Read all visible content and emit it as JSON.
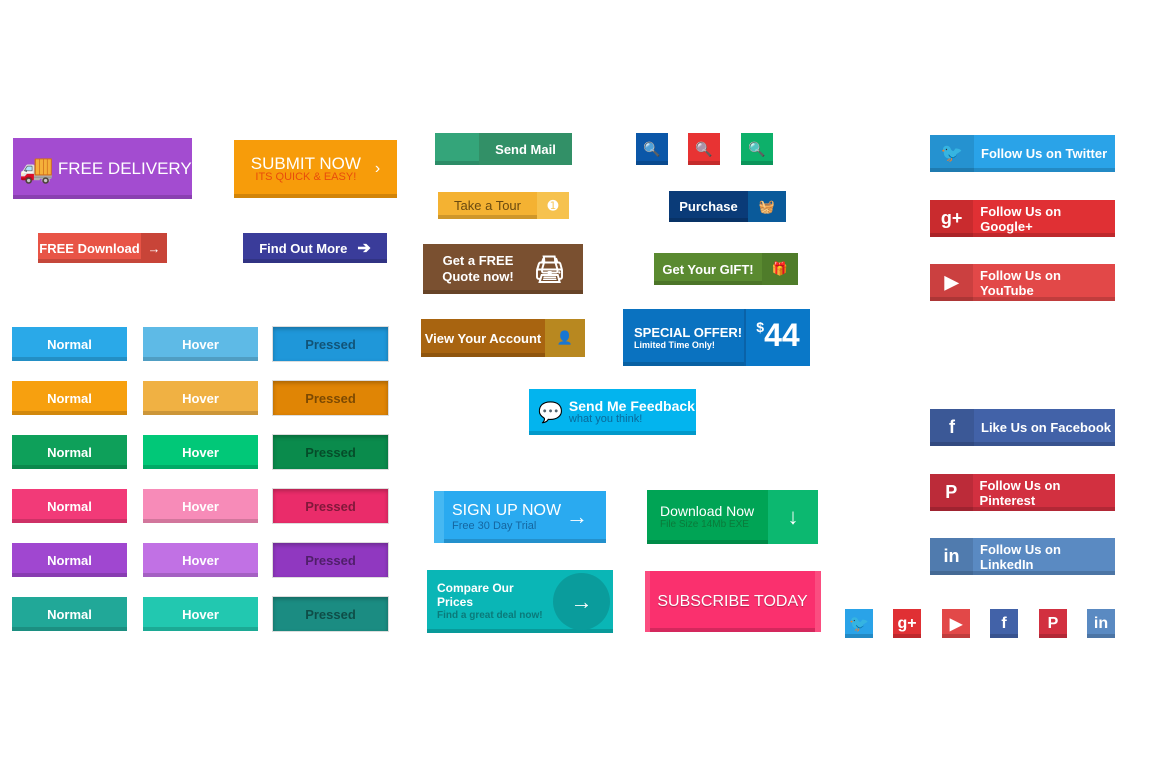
{
  "hero": {
    "free_delivery": "FREE DELIVERY",
    "submit_now": "SUBMIT NOW",
    "submit_sub": "ITS QUICK & EASY!",
    "free_download": "FREE Download",
    "find_out_more": "Find Out More"
  },
  "middle": {
    "send_mail": "Send Mail",
    "take_tour": "Take a Tour",
    "quote_line1": "Get a FREE",
    "quote_line2": "Quote now!",
    "view_account": "View Your Account",
    "purchase": "Purchase",
    "gift": "Get Your GIFT!",
    "special": "SPECIAL OFFER!",
    "special_sub": "Limited Time Only!",
    "currency": "$",
    "price": "44",
    "feedback": "Send Me Feedback",
    "feedback_sub": "what you think!",
    "signup": "SIGN UP NOW",
    "signup_sub": "Free 30 Day Trial",
    "download": "Download Now",
    "download_sub": "File Size 14Mb EXE",
    "compare": "Compare Our Prices",
    "compare_sub": "Find a great deal now!",
    "subscribe": "SUBSCRIBE TODAY"
  },
  "search_buttons": [
    {
      "color": "#0b57a8"
    },
    {
      "color": "#e83333"
    },
    {
      "color": "#0db06a"
    }
  ],
  "states": {
    "labels": [
      "Normal",
      "Hover",
      "Pressed"
    ],
    "rows": [
      {
        "colors": [
          "#2aa9e8",
          "#5ebae6",
          "#1f97d9"
        ]
      },
      {
        "colors": [
          "#f7a00f",
          "#f0b143",
          "#e08505"
        ]
      },
      {
        "colors": [
          "#0ea05a",
          "#01c878",
          "#0a8b4c"
        ]
      },
      {
        "colors": [
          "#f23a78",
          "#f78bb8",
          "#ea2c6a"
        ]
      },
      {
        "colors": [
          "#a047d0",
          "#c171e4",
          "#9038c0"
        ]
      },
      {
        "colors": [
          "#21a898",
          "#22c8b0",
          "#1b8c82"
        ]
      }
    ]
  },
  "social": [
    {
      "label": "Follow Us on Twitter",
      "icon": "twitter-icon",
      "glyph": "🐦",
      "color": "#2aa3e8"
    },
    {
      "label": "Follow Us on Google+",
      "icon": "google-plus-icon",
      "glyph": "g+",
      "color": "#e03034"
    },
    {
      "label": "Follow Us on YouTube",
      "icon": "youtube-icon",
      "glyph": "▶",
      "color": "#e24848"
    },
    {
      "label": "Like Us on Facebook",
      "icon": "facebook-icon",
      "glyph": "f",
      "color": "#4262a8"
    },
    {
      "label": "Follow Us on Pinterest",
      "icon": "pinterest-icon",
      "glyph": "P",
      "color": "#d23040"
    },
    {
      "label": "Follow Us on LinkedIn",
      "icon": "linkedin-icon",
      "glyph": "in",
      "color": "#5a8ac2"
    }
  ]
}
